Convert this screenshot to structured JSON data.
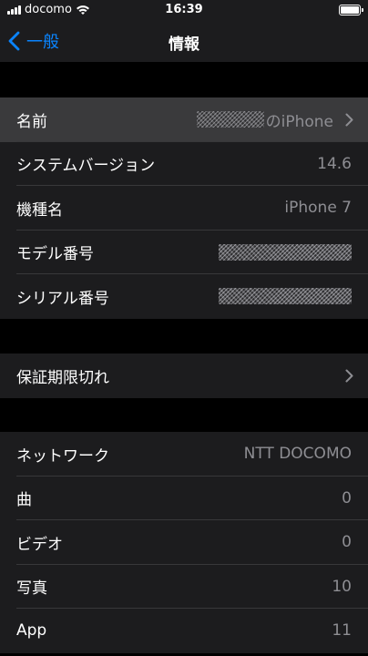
{
  "status_bar": {
    "carrier": "docomo",
    "time": "16:39"
  },
  "nav": {
    "back_label": "一般",
    "title": "情報"
  },
  "section1": {
    "name_label": "名前",
    "name_value": "のiPhone",
    "system_version_label": "システムバージョン",
    "system_version_value": "14.6",
    "model_name_label": "機種名",
    "model_name_value": "iPhone 7",
    "model_number_label": "モデル番号",
    "serial_label": "シリアル番号"
  },
  "section2": {
    "warranty_label": "保証期限切れ"
  },
  "section3": {
    "network_label": "ネットワーク",
    "network_value": "NTT DOCOMO",
    "songs_label": "曲",
    "songs_value": "0",
    "videos_label": "ビデオ",
    "videos_value": "0",
    "photos_label": "写真",
    "photos_value": "10",
    "app_label": "App",
    "app_value": "11"
  },
  "colors": {
    "accent": "#0a84ff",
    "row_bg": "#1c1c1e",
    "selected_bg": "#3a3a3c",
    "secondary_text": "#8e8e93"
  }
}
